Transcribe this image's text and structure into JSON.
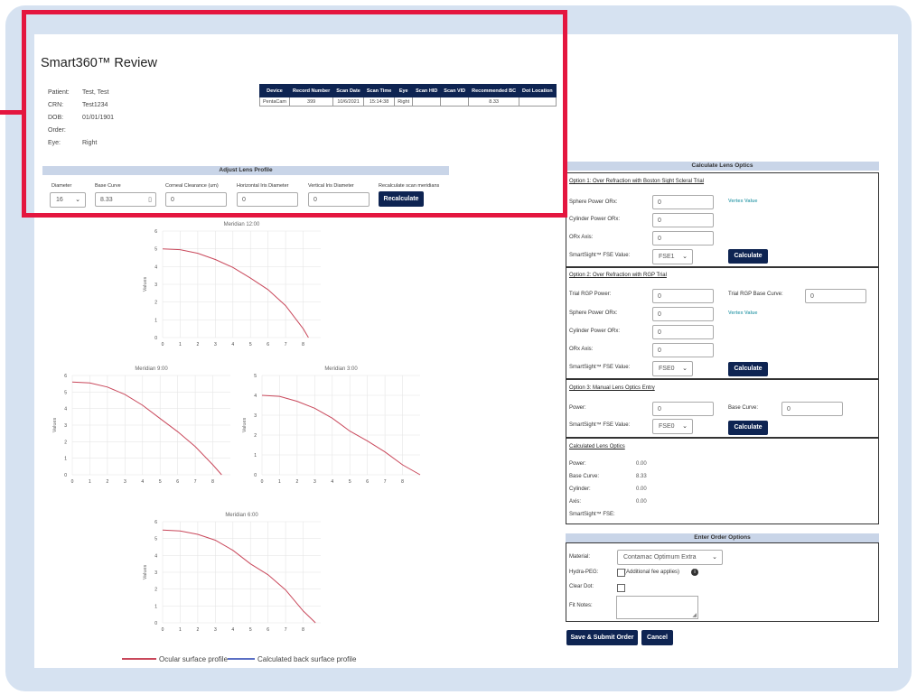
{
  "title": "Smart360™ Review",
  "patient": {
    "rows": [
      {
        "k": "Patient:",
        "v": "Test, Test"
      },
      {
        "k": "CRN:",
        "v": "Test1234"
      },
      {
        "k": "DOB:",
        "v": "01/01/1901"
      },
      {
        "k": "Order:",
        "v": ""
      },
      {
        "k": "Eye:",
        "v": "Right"
      }
    ]
  },
  "scan_table": {
    "headers": [
      "Device",
      "Record Number",
      "Scan Date",
      "Scan Time",
      "Eye",
      "Scan HID",
      "Scan VID",
      "Recommended BC",
      "Dot Location"
    ],
    "row": [
      "PentaCam",
      "399",
      "10/6/2021",
      "15:14:38",
      "Right",
      "",
      "",
      "8.33",
      ""
    ]
  },
  "adjust": {
    "title": "Adjust Lens Profile",
    "diameter_label": "Diameter",
    "diameter_value": "16",
    "base_curve_label": "Base Curve",
    "base_curve_value": "8.33",
    "corneal_label": "Corneal Clearance (um)",
    "corneal_value": "0",
    "hid_label": "Horizontal Iris Diameter",
    "hid_value": "0",
    "vid_label": "Vertical Iris Diameter",
    "vid_value": "0",
    "recalc_label": "Recalculate scan meridians",
    "recalc_button": "Recalculate"
  },
  "charts_common": {
    "ylabel": "Values"
  },
  "legend": {
    "ocular": "Ocular surface profile",
    "calculated": "Calculated back surface profile",
    "ocular_color": "#c9485b",
    "calculated_color": "#5a6fc4"
  },
  "chart_data": [
    {
      "type": "line",
      "title": "Meridian 12:00",
      "x": [
        0,
        1,
        2,
        3,
        4,
        5,
        6,
        7,
        8,
        8.3
      ],
      "series": [
        {
          "name": "Ocular surface profile",
          "values": [
            5,
            4.95,
            4.75,
            4.4,
            3.95,
            3.35,
            2.7,
            1.8,
            0.5,
            0
          ]
        }
      ],
      "xlim": [
        0,
        8
      ],
      "ylim": [
        0,
        6
      ]
    },
    {
      "type": "line",
      "title": "Meridian 9:00",
      "x": [
        0,
        1,
        2,
        3,
        4,
        5,
        6,
        7,
        8,
        8.5
      ],
      "series": [
        {
          "name": "Ocular surface profile",
          "values": [
            5.6,
            5.55,
            5.3,
            4.85,
            4.2,
            3.4,
            2.6,
            1.7,
            0.6,
            0
          ]
        }
      ],
      "xlim": [
        0,
        8
      ],
      "ylim": [
        0,
        6
      ]
    },
    {
      "type": "line",
      "title": "Meridian 3:00",
      "x": [
        0,
        1,
        2,
        3,
        4,
        5,
        6,
        7,
        8,
        9
      ],
      "series": [
        {
          "name": "Ocular surface profile",
          "values": [
            4,
            3.95,
            3.7,
            3.35,
            2.85,
            2.2,
            1.7,
            1.15,
            0.5,
            0
          ]
        }
      ],
      "xlim": [
        0,
        8
      ],
      "ylim": [
        0,
        5
      ]
    },
    {
      "type": "line",
      "title": "Meridian 6:00",
      "x": [
        0,
        1,
        2,
        3,
        4,
        5,
        6,
        7,
        8,
        8.7
      ],
      "series": [
        {
          "name": "Ocular surface profile",
          "values": [
            5.5,
            5.45,
            5.25,
            4.9,
            4.3,
            3.5,
            2.85,
            1.95,
            0.7,
            0
          ]
        }
      ],
      "xlim": [
        0,
        8
      ],
      "ylim": [
        0,
        6
      ]
    }
  ],
  "calc": {
    "title": "Calculate Lens Optics",
    "opt1": {
      "heading": "Option 1: Over Refraction with Boston Sight Scleral Trial",
      "sphere_label": "Sphere Power ORx:",
      "sphere_value": "0",
      "cyl_label": "Cylinder Power ORx:",
      "cyl_value": "0",
      "axis_label": "ORx Axis:",
      "axis_value": "0",
      "fse_label": "SmartSight™ FSE Value:",
      "fse_value": "FSE1",
      "vertex": "Vertex Value",
      "button": "Calculate"
    },
    "opt2": {
      "heading": "Option 2: Over Refraction with RGP Trial",
      "trial_label": "Trial RGP Power:",
      "trial_value": "0",
      "trial_bc_label": "Trial RGP Base Curve:",
      "trial_bc_value": "0",
      "sphere_label": "Sphere Power ORx:",
      "sphere_value": "0",
      "cyl_label": "Cylinder Power ORx:",
      "cyl_value": "0",
      "axis_label": "ORx Axis:",
      "axis_value": "0",
      "fse_label": "SmartSight™ FSE Value:",
      "fse_value": "FSE0",
      "vertex": "Vertex Value",
      "button": "Calculate"
    },
    "opt3": {
      "heading": "Option 3: Manual Lens Optics Entry",
      "power_label": "Power:",
      "power_value": "0",
      "bc_label": "Base Curve:",
      "bc_value": "0",
      "fse_label": "SmartSight™ FSE Value:",
      "fse_value": "FSE0",
      "button": "Calculate"
    },
    "result": {
      "heading": "Calculated Lens Optics",
      "power_label": "Power:",
      "power_value": "0.00",
      "bc_label": "Base Curve:",
      "bc_value": "8.33",
      "cyl_label": "Cylinder:",
      "cyl_value": "0.00",
      "axis_label": "Axis:",
      "axis_value": "0.00",
      "fse_label": "SmartSight™ FSE:",
      "fse_value": ""
    }
  },
  "order": {
    "title": "Enter Order Options",
    "material_label": "Material:",
    "material_value": "Contamac Optimum Extra",
    "hydra_label": "Hydra-PEG:",
    "hydra_note": "(Additional fee applies)",
    "cleardot_label": "Clear Dot:",
    "fitnotes_label": "Fit Notes:",
    "save_button": "Save & Submit Order",
    "cancel_button": "Cancel"
  }
}
